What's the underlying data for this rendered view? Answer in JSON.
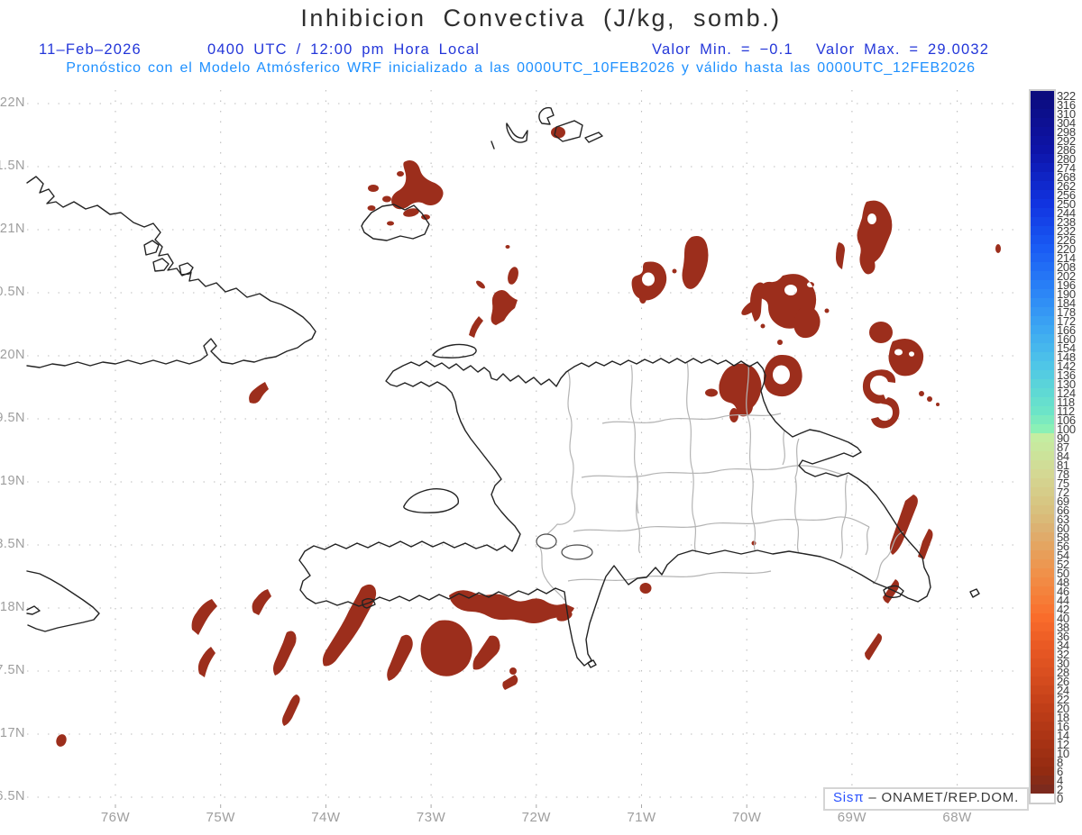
{
  "header": {
    "title": "Inhibicion Convectiva (J/kg, somb.)",
    "date": "11–Feb–2026",
    "time": "0400 UTC / 12:00 pm Hora Local",
    "valor_min": "Valor Min. = −0.1",
    "valor_max": "Valor Max. = 29.0032",
    "forecast": "Pronóstico con el Modelo Atmósferico WRF inicializado a las 0000UTC_10FEB2026 y válido hasta las  0000UTC_12FEB2026"
  },
  "axes": {
    "y_labels": [
      "22N",
      "1.5N",
      "21N",
      "0.5N",
      "20N",
      "9.5N",
      "19N",
      "8.5N",
      "18N",
      "7.5N",
      "17N",
      "6.5N"
    ],
    "x_labels": [
      "76W",
      "75W",
      "74W",
      "73W",
      "72W",
      "71W",
      "70W",
      "69W",
      "68W"
    ]
  },
  "colorbar": {
    "values": [
      322,
      316,
      310,
      304,
      298,
      292,
      286,
      280,
      274,
      268,
      262,
      256,
      250,
      244,
      238,
      232,
      226,
      220,
      214,
      208,
      202,
      196,
      190,
      184,
      178,
      172,
      166,
      160,
      154,
      148,
      142,
      136,
      130,
      124,
      118,
      112,
      106,
      100,
      90,
      87,
      84,
      81,
      78,
      75,
      72,
      69,
      66,
      63,
      60,
      58,
      56,
      54,
      52,
      50,
      48,
      46,
      44,
      42,
      40,
      38,
      36,
      34,
      32,
      30,
      28,
      26,
      24,
      22,
      20,
      18,
      16,
      14,
      12,
      10,
      8,
      6,
      4,
      2,
      0
    ],
    "stops": [
      [
        0,
        "#0c0c7e"
      ],
      [
        6,
        "#0d14a8"
      ],
      [
        12,
        "#1133e0"
      ],
      [
        17,
        "#1a5cf4"
      ],
      [
        22,
        "#2c86f6"
      ],
      [
        26,
        "#3da8f2"
      ],
      [
        30,
        "#4fc6e7"
      ],
      [
        33,
        "#5fd9d4"
      ],
      [
        35,
        "#6ce4c8"
      ],
      [
        37,
        "#8af0b6"
      ],
      [
        38,
        "#c4eda1"
      ],
      [
        42,
        "#d4d893"
      ],
      [
        46,
        "#d8c17e"
      ],
      [
        48,
        "#dcb272"
      ],
      [
        51,
        "#e89e59"
      ],
      [
        53,
        "#f0914a"
      ],
      [
        56,
        "#f67c37"
      ],
      [
        58,
        "#f96c2b"
      ],
      [
        61,
        "#ea5a24"
      ],
      [
        64,
        "#da4f20"
      ],
      [
        68,
        "#c03e18"
      ],
      [
        72,
        "#a63214"
      ],
      [
        75,
        "#922b11"
      ],
      [
        77,
        "#7c2a1d"
      ],
      [
        78,
        "#ffffff"
      ]
    ]
  },
  "credit": {
    "brand": "Sisπ",
    "rest": "– ONAMET/REP.DOM."
  },
  "colors": {
    "subtitle_blue": "#2336d9",
    "forecast_blue": "#1e90ff",
    "axis_gray": "#9e9e9e",
    "grid_gray": "#bdbdbd",
    "coast_black": "#232323",
    "province_gray": "#b4b4b4",
    "cin_red": "#9c2e1c"
  }
}
